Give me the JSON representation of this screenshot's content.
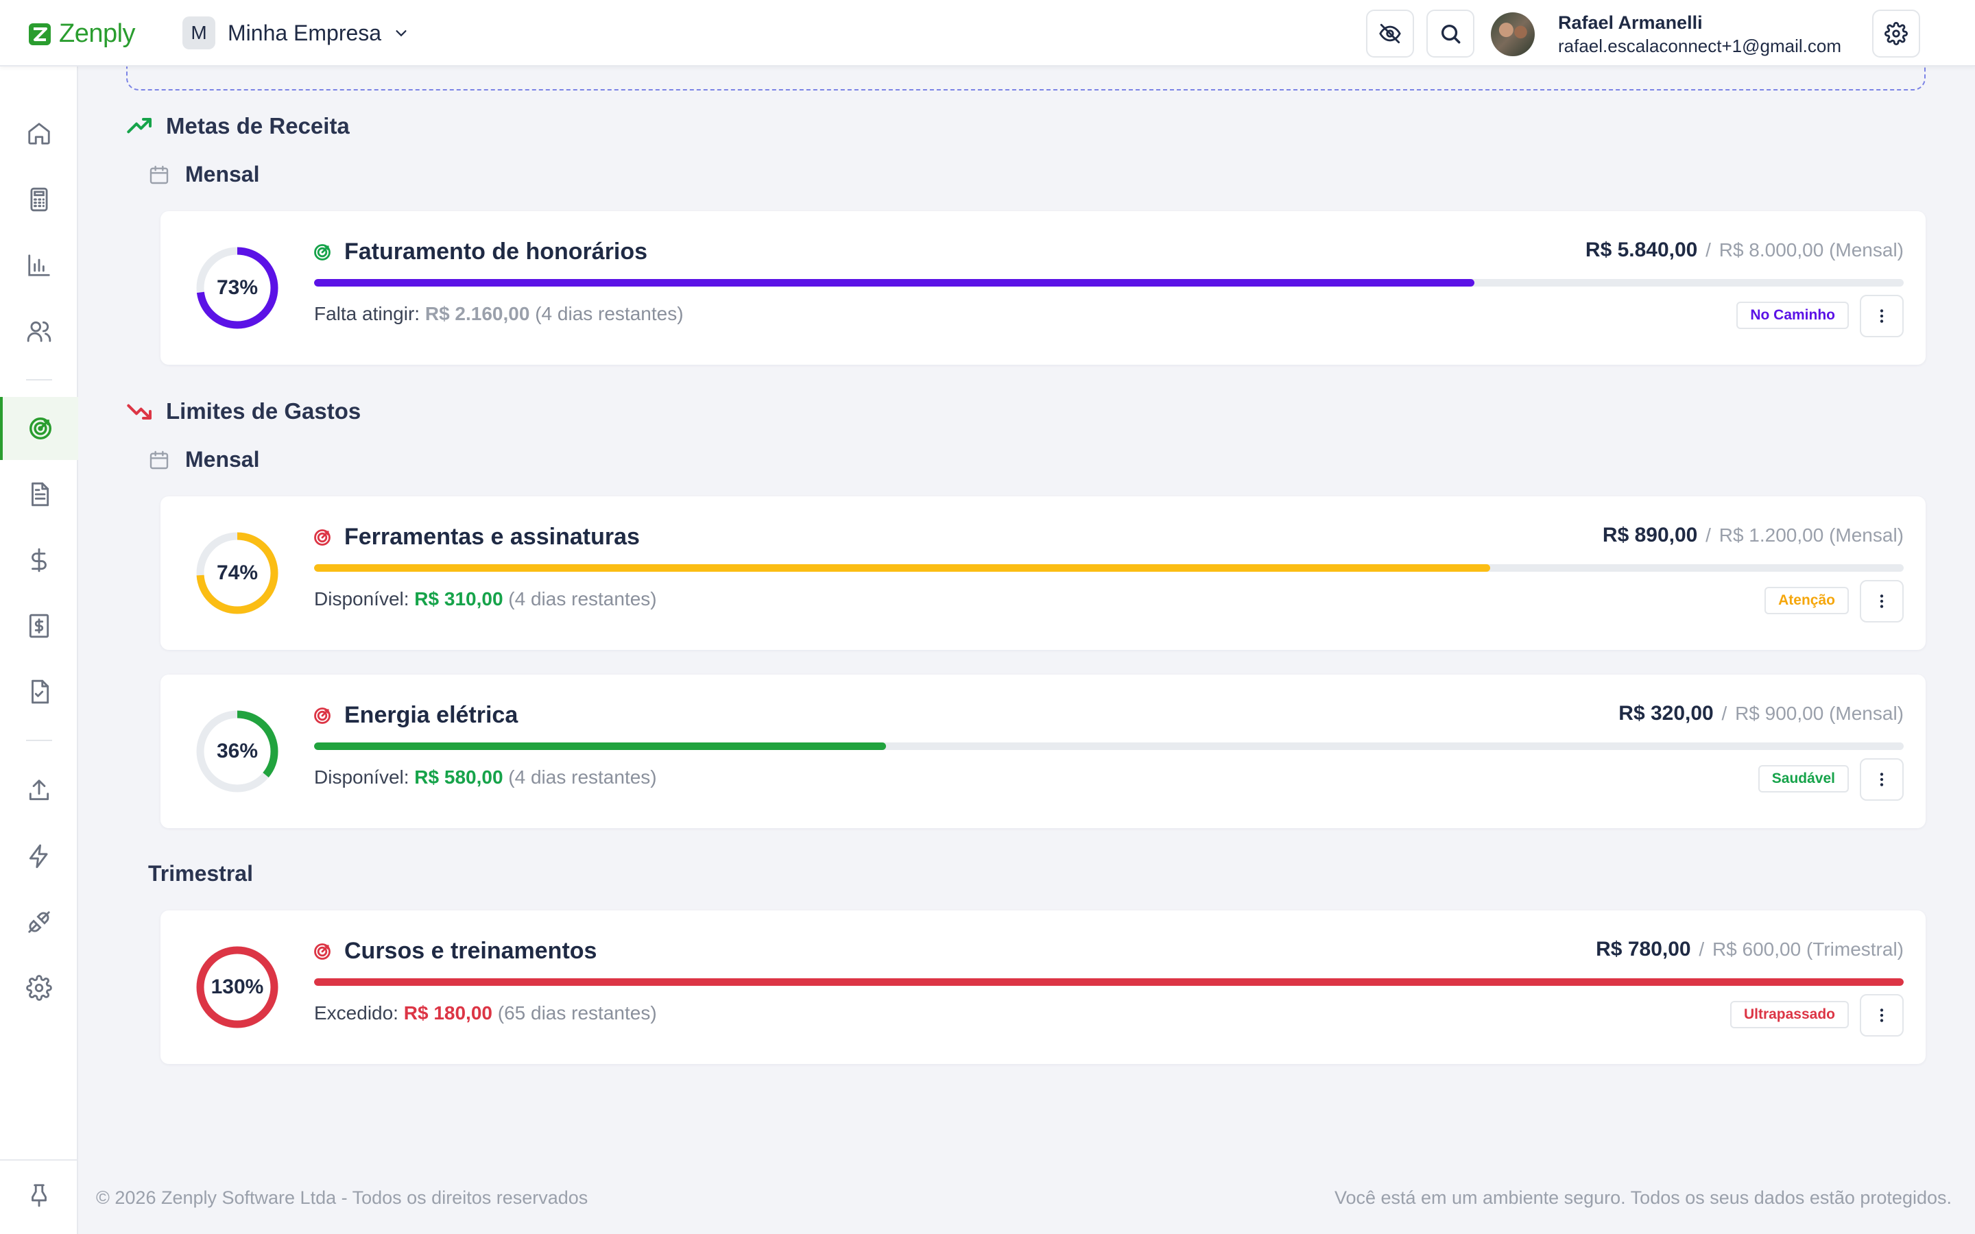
{
  "app": {
    "name": "Zenply",
    "brand_color": "#2a9d2f"
  },
  "company": {
    "initial": "M",
    "name": "Minha Empresa"
  },
  "user": {
    "name": "Rafael Armanelli",
    "email": "rafael.escalaconnect+1@gmail.com"
  },
  "header_icons": [
    "eye-off-icon",
    "search-icon",
    "gear-icon"
  ],
  "sidebar": {
    "items": [
      "home-icon",
      "calculator-icon",
      "bar-chart-icon",
      "users-icon",
      "goals-icon",
      "document-icon",
      "dollar-icon",
      "invoice-icon",
      "checklist-icon",
      "upload-icon",
      "lightning-icon",
      "plug-icon",
      "gear-icon"
    ],
    "active": "goals-icon",
    "footer_icon": "pin-icon"
  },
  "revenue": {
    "title": "Metas de Receita",
    "period": "Mensal",
    "goals": [
      {
        "percent": "73%",
        "progress": 0.73,
        "color": "#5b12e6",
        "title": "Faturamento de honorários",
        "current": "R$ 5.840,00",
        "target": "R$ 8.000,00",
        "period": "(Mensal)",
        "label": "Falta atingir:",
        "amount": "R$ 2.160,00",
        "remaining": "(4 dias restantes)",
        "status": "No Caminho",
        "status_color": "#5b12e6"
      }
    ]
  },
  "expenses": {
    "title": "Limites de Gastos",
    "period": "Mensal",
    "period2": "Trimestral",
    "limits": [
      {
        "percent": "74%",
        "progress": 0.74,
        "color": "#fbbd14",
        "title": "Ferramentas e assinaturas",
        "current": "R$ 890,00",
        "target": "R$ 1.200,00",
        "period": "(Mensal)",
        "label": "Disponível:",
        "amount": "R$ 310,00",
        "amount_color": "#16a34a",
        "remaining": "(4 dias restantes)",
        "status": "Atenção",
        "status_color": "#f5a60b"
      },
      {
        "percent": "36%",
        "progress": 0.36,
        "color": "#21a33e",
        "title": "Energia elétrica",
        "current": "R$ 320,00",
        "target": "R$ 900,00",
        "period": "(Mensal)",
        "label": "Disponível:",
        "amount": "R$ 580,00",
        "amount_color": "#16a34a",
        "remaining": "(4 dias restantes)",
        "status": "Saudável",
        "status_color": "#16a34a"
      },
      {
        "percent": "130%",
        "progress": 1.0,
        "color": "#dc3545",
        "title": "Cursos e treinamentos",
        "current": "R$ 780,00",
        "target": "R$ 600,00",
        "period": "(Trimestral)",
        "label": "Excedido:",
        "amount": "R$ 180,00",
        "amount_color": "#dc3545",
        "remaining": "(65 dias restantes)",
        "status": "Ultrapassado",
        "status_color": "#dc3545"
      }
    ]
  },
  "footer": {
    "left": "© 2026 Zenply Software Ltda - Todos os direitos reservados",
    "right": "Você está em um ambiente seguro. Todos os seus dados estão protegidos."
  }
}
